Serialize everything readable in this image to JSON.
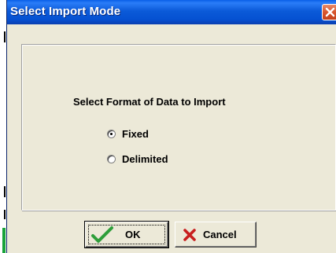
{
  "window": {
    "title": "Select Import Mode",
    "close_icon": "close-icon"
  },
  "main": {
    "prompt": "Select Format of Data to Import",
    "options": [
      {
        "label": "Fixed",
        "selected": true
      },
      {
        "label": "Delimited",
        "selected": false
      }
    ]
  },
  "buttons": {
    "ok_label": "OK",
    "ok_icon": "checkmark-icon",
    "cancel_label": "Cancel",
    "cancel_icon": "x-cross-icon"
  },
  "colors": {
    "titlebar": "#0b5ad8",
    "close_button": "#d8562e",
    "face": "#ece9d8",
    "checkmark": "#2e9e3a",
    "cancel_cross": "#c81e1e"
  }
}
